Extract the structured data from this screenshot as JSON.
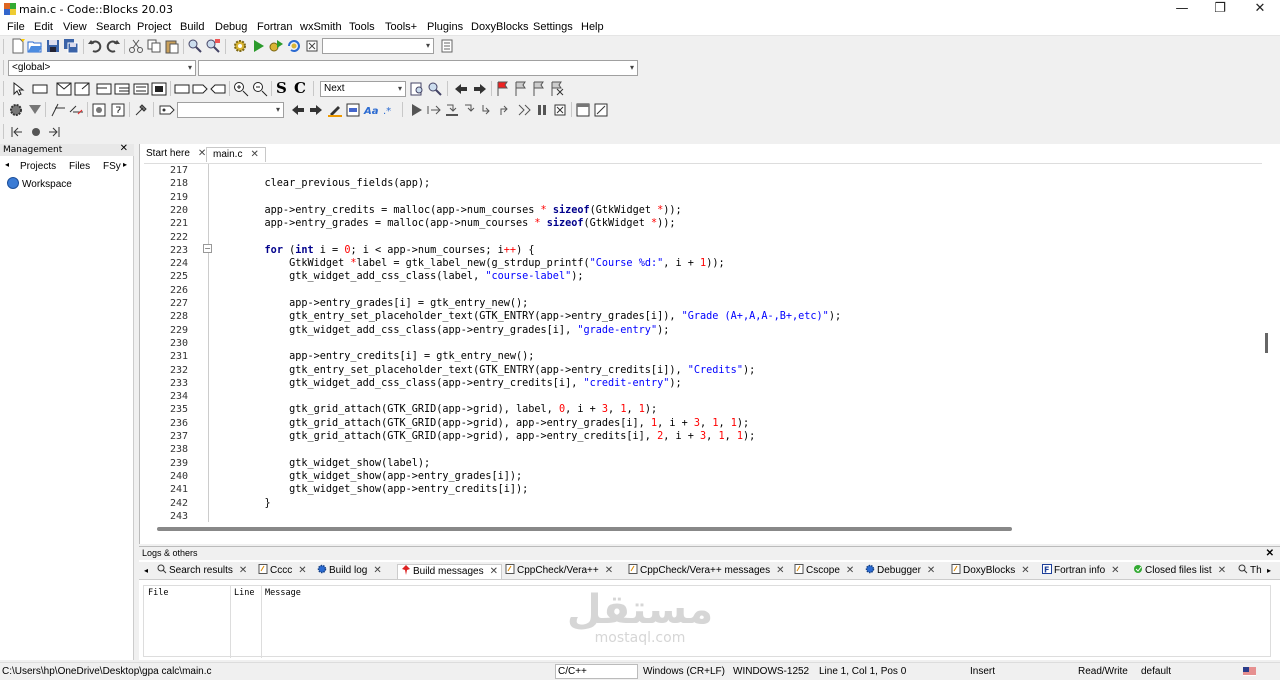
{
  "window": {
    "title": "main.c - Code::Blocks 20.03",
    "minimize": "—",
    "restore": "❐",
    "close": "✕"
  },
  "menu": [
    "File",
    "Edit",
    "View",
    "Search",
    "Project",
    "Build",
    "Debug",
    "Fortran",
    "wxSmith",
    "Tools",
    "Tools+",
    "Plugins",
    "DoxyBlocks",
    "Settings",
    "Help"
  ],
  "toolbar": {
    "scope_combo": "<global>",
    "search_combo": "Next",
    "symbol_s": "S",
    "symbol_c": "C"
  },
  "management": {
    "title": "Management",
    "close": "✕",
    "tabs": [
      "Projects",
      "Files",
      "FSy"
    ],
    "left_arrow": "◂",
    "right_arrow": "▸",
    "workspace": "Workspace"
  },
  "editor": {
    "tabs": [
      {
        "label": "Start here",
        "close": "✕"
      },
      {
        "label": "main.c",
        "close": "✕"
      }
    ],
    "fold_marker": "⊟",
    "line_numbers": [
      "217",
      "218",
      "219",
      "220",
      "221",
      "222",
      "223",
      "224",
      "225",
      "226",
      "227",
      "228",
      "229",
      "230",
      "231",
      "232",
      "233",
      "234",
      "235",
      "236",
      "237",
      "238",
      "239",
      "240",
      "241",
      "242",
      "243"
    ],
    "lines": [
      "",
      "    clear_previous_fields(app);",
      "",
      "    app->entry_credits = malloc(app->num_courses * sizeof(GtkWidget *));",
      "    app->entry_grades = malloc(app->num_courses * sizeof(GtkWidget *));",
      "",
      "    for (int i = 0; i < app->num_courses; i++) {",
      "        GtkWidget *label = gtk_label_new(g_strdup_printf(\"Course %d:\", i + 1));",
      "        gtk_widget_add_css_class(label, \"course-label\");",
      "",
      "        app->entry_grades[i] = gtk_entry_new();",
      "        gtk_entry_set_placeholder_text(GTK_ENTRY(app->entry_grades[i]), \"Grade (A+,A,A-,B+,etc)\");",
      "        gtk_widget_add_css_class(app->entry_grades[i], \"grade-entry\");",
      "",
      "        app->entry_credits[i] = gtk_entry_new();",
      "        gtk_entry_set_placeholder_text(GTK_ENTRY(app->entry_credits[i]), \"Credits\");",
      "        gtk_widget_add_css_class(app->entry_credits[i], \"credit-entry\");",
      "",
      "        gtk_grid_attach(GTK_GRID(app->grid), label, 0, i + 3, 1, 1);",
      "        gtk_grid_attach(GTK_GRID(app->grid), app->entry_grades[i], 1, i + 3, 1, 1);",
      "        gtk_grid_attach(GTK_GRID(app->grid), app->entry_credits[i], 2, i + 3, 1, 1);",
      "",
      "        gtk_widget_show(label);",
      "        gtk_widget_show(app->entry_grades[i]);",
      "        gtk_widget_show(app->entry_credits[i]);",
      "    }",
      ""
    ]
  },
  "logs": {
    "title": "Logs & others",
    "close": "✕",
    "left_arrow": "◂",
    "right_arrow": "▸",
    "tabs": [
      {
        "label": "Search results",
        "close": "✕"
      },
      {
        "label": "Cccc",
        "close": "✕"
      },
      {
        "label": "Build log",
        "close": "✕"
      },
      {
        "label": "Build messages",
        "close": "✕"
      },
      {
        "label": "CppCheck/Vera++",
        "close": "✕"
      },
      {
        "label": "CppCheck/Vera++ messages",
        "close": "✕"
      },
      {
        "label": "Cscope",
        "close": "✕"
      },
      {
        "label": "Debugger",
        "close": "✕"
      },
      {
        "label": "DoxyBlocks",
        "close": "✕"
      },
      {
        "label": "Fortran info",
        "close": "✕"
      },
      {
        "label": "Closed files list",
        "close": "✕"
      },
      {
        "label": "Th"
      }
    ],
    "columns": [
      "File",
      "Line",
      "Message"
    ]
  },
  "status": {
    "path": "C:\\Users\\hp\\OneDrive\\Desktop\\gpa calc\\main.c",
    "language": "C/C++",
    "eol": "Windows (CR+LF)",
    "encoding": "WINDOWS-1252",
    "position": "Line 1, Col 1, Pos 0",
    "mode": "Insert",
    "access": "Read/Write",
    "theme": "default"
  },
  "watermark": {
    "arabic": "مستقل",
    "latin": "mostaql.com"
  },
  "colors": {
    "keyword": "#00008b",
    "string": "#0000ff",
    "number": "#ff0000"
  }
}
